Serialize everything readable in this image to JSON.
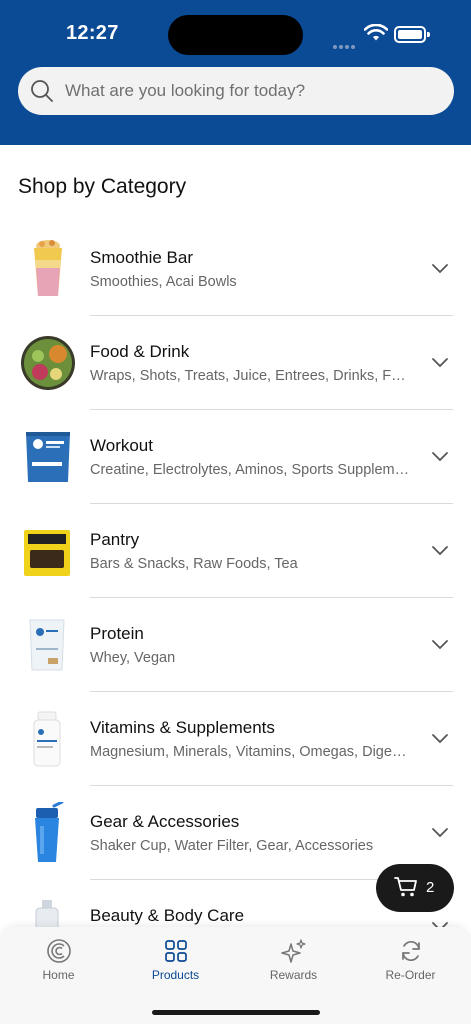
{
  "status_bar": {
    "time": "12:27"
  },
  "search": {
    "placeholder": "What are you looking for today?"
  },
  "section_title": "Shop by Category",
  "categories": [
    {
      "title": "Smoothie Bar",
      "subtitle": "Smoothies, Acai Bowls",
      "icon": "smoothie-cup-image"
    },
    {
      "title": "Food & Drink",
      "subtitle": "Wraps, Shots, Treats, Juice, Entrees, Drinks, Food",
      "icon": "salad-bowl-image"
    },
    {
      "title": "Workout",
      "subtitle": "Creatine, Electrolytes, Aminos, Sports Supplements",
      "icon": "creatine-bag-image"
    },
    {
      "title": "Pantry",
      "subtitle": "Bars & Snacks, Raw Foods, Tea",
      "icon": "snack-bar-image"
    },
    {
      "title": "Protein",
      "subtitle": "Whey, Vegan",
      "icon": "protein-pouch-image"
    },
    {
      "title": "Vitamins & Supplements",
      "subtitle": "Magnesium, Minerals, Vitamins, Omegas, Digestive",
      "icon": "supplement-bottle-image"
    },
    {
      "title": "Gear & Accessories",
      "subtitle": "Shaker Cup, Water Filter, Gear, Accessories",
      "icon": "shaker-bottle-image"
    },
    {
      "title": "Beauty & Body Care",
      "subtitle": "",
      "icon": "body-care-bottle-image"
    }
  ],
  "cart": {
    "count": "2",
    "icon": "cart-icon"
  },
  "tabs": [
    {
      "label": "Home",
      "icon": "home-logo-icon",
      "active": false
    },
    {
      "label": "Products",
      "icon": "grid-icon",
      "active": true
    },
    {
      "label": "Rewards",
      "icon": "sparkle-icon",
      "active": false
    },
    {
      "label": "Re-Order",
      "icon": "refresh-icon",
      "active": false
    }
  ],
  "colors": {
    "brand_blue": "#0b4a94",
    "cart_bg": "#1a1a1a"
  }
}
